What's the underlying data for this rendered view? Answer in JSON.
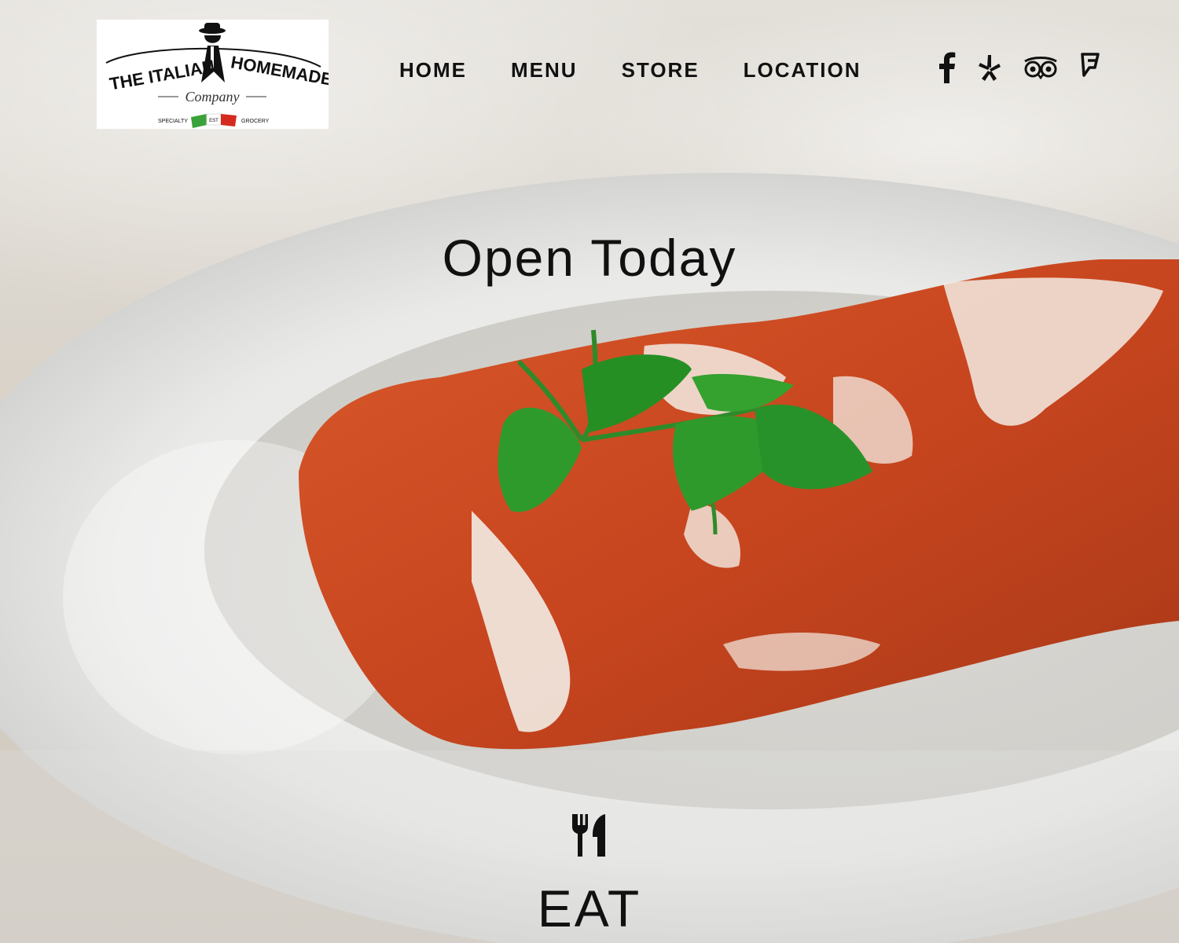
{
  "logo": {
    "line1": "THE ITALIAN",
    "line2": "HOMEMADE",
    "line3": "Company",
    "tagline_left": "SPECIALTY",
    "tagline_mid": "EST",
    "tagline_right": "GROCERY"
  },
  "nav": {
    "items": [
      {
        "label": "HOME"
      },
      {
        "label": "MENU"
      },
      {
        "label": "STORE"
      },
      {
        "label": "LOCATION"
      }
    ]
  },
  "social": {
    "icons": [
      "facebook-icon",
      "yelp-icon",
      "tripadvisor-icon",
      "foursquare-icon"
    ]
  },
  "hero": {
    "headline": "Open Today"
  },
  "section": {
    "icon": "fork-knife-icon",
    "label": "EAT"
  },
  "colors": {
    "text": "#111111",
    "sauce": "#c8461f",
    "parsley": "#2e8b2a",
    "plate": "#f2f2f0"
  }
}
